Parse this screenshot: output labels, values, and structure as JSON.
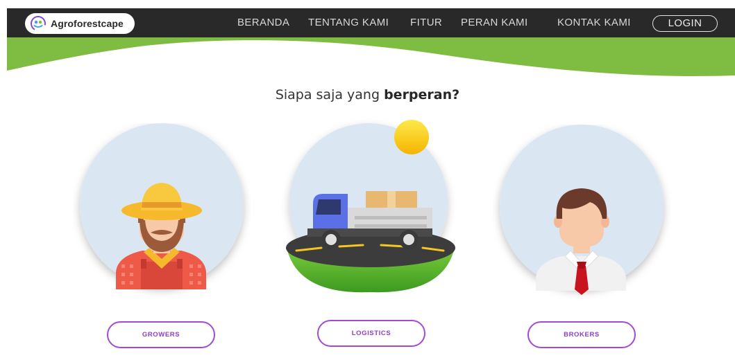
{
  "brand": {
    "name": "Agroforestcape",
    "icon": "agroforestcape-logo-icon"
  },
  "nav": {
    "beranda": "BERANDA",
    "tentang": "TENTANG KAMI",
    "fitur": "FITUR",
    "peran": "PERAN KAMI",
    "kontak": "KONTAK KAMI",
    "login": "LOGIN"
  },
  "heading": {
    "prefix": "Siapa saja yang ",
    "emphasis": "berperan?"
  },
  "roles": [
    {
      "label": "GROWERS",
      "icon": "farmer-icon"
    },
    {
      "label": "LOGISTICS",
      "icon": "delivery-truck-icon"
    },
    {
      "label": "BROKERS",
      "icon": "businessman-icon"
    }
  ],
  "colors": {
    "navbar": "#292929",
    "accent_green": "#7ebd42",
    "button_purple": "#a24ad4",
    "circle_bg": "#dbe6f3"
  }
}
